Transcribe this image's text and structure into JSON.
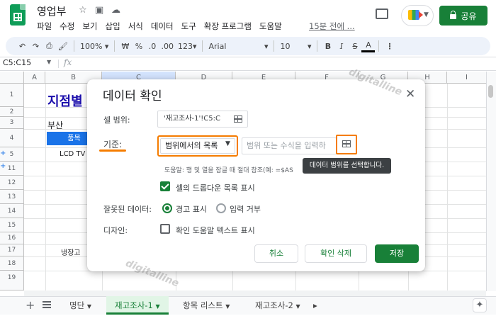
{
  "app": {
    "doc_title": "영업부",
    "last_edit": "15분 전에 ...",
    "share_label": "공유",
    "menu": [
      "파일",
      "수정",
      "보기",
      "삽입",
      "서식",
      "데이터",
      "도구",
      "확장 프로그램",
      "도움말"
    ]
  },
  "toolbar": {
    "zoom": "100%",
    "currency": "₩",
    "percent": "%",
    "dec_less": ".0",
    ".00": ".00",
    "more_formats": "123",
    "font": "Arial",
    "font_size": "10",
    "bold": "B",
    "italic": "I",
    "strike": "S",
    "text_color": "A"
  },
  "formula_bar": {
    "name_box": "C5:C15",
    "fx": "fx"
  },
  "grid": {
    "columns": [
      "A",
      "B",
      "C",
      "D",
      "E",
      "F",
      "G",
      "H",
      "I"
    ],
    "rows": [
      "1",
      "2",
      "3",
      "4",
      "5",
      "11",
      "12",
      "13",
      "14",
      "15",
      "16",
      "17",
      "18",
      "19"
    ],
    "cells": {
      "title": "지점별",
      "busan": "부산",
      "header": "품목",
      "lcd": "LCD TV",
      "fridge": "냉장고"
    }
  },
  "sheets": {
    "tabs": [
      "명단",
      "재고조사-1",
      "항목 리스트",
      "재고조사-2"
    ],
    "active": "재고조사-1"
  },
  "dialog": {
    "title": "데이터 확인",
    "cell_range_label": "셀 범위:",
    "cell_range_value": "'재고조사-1'!C5:C",
    "criteria_label": "기준:",
    "criteria_value": "범위에서의 목록",
    "criteria_placeholder": "범위 또는 수식을 입력하",
    "help_text": "도움말: 행 및 열을 잠글 때 절대 참조(예: =$AS",
    "tooltip": "데이터 범위를 선택합니다.",
    "show_dropdown_label": "셀의 드롭다운 목록 표시",
    "show_dropdown_checked": true,
    "invalid_label": "잘못된 데이터:",
    "invalid_opt_warn": "경고 표시",
    "invalid_opt_reject": "입력 거부",
    "invalid_selected": "경고 표시",
    "appearance_label": "디자인:",
    "help_checkbox_label": "확인 도움말 텍스트 표시",
    "help_checkbox_checked": false,
    "cancel": "취소",
    "remove": "확인 삭제",
    "save": "저장"
  },
  "watermark": "digitalline",
  "colors": {
    "brand_green": "#188038",
    "highlight_orange": "#f57c00",
    "header_blue": "#1a73e8",
    "title_blue": "#1a0dab"
  }
}
